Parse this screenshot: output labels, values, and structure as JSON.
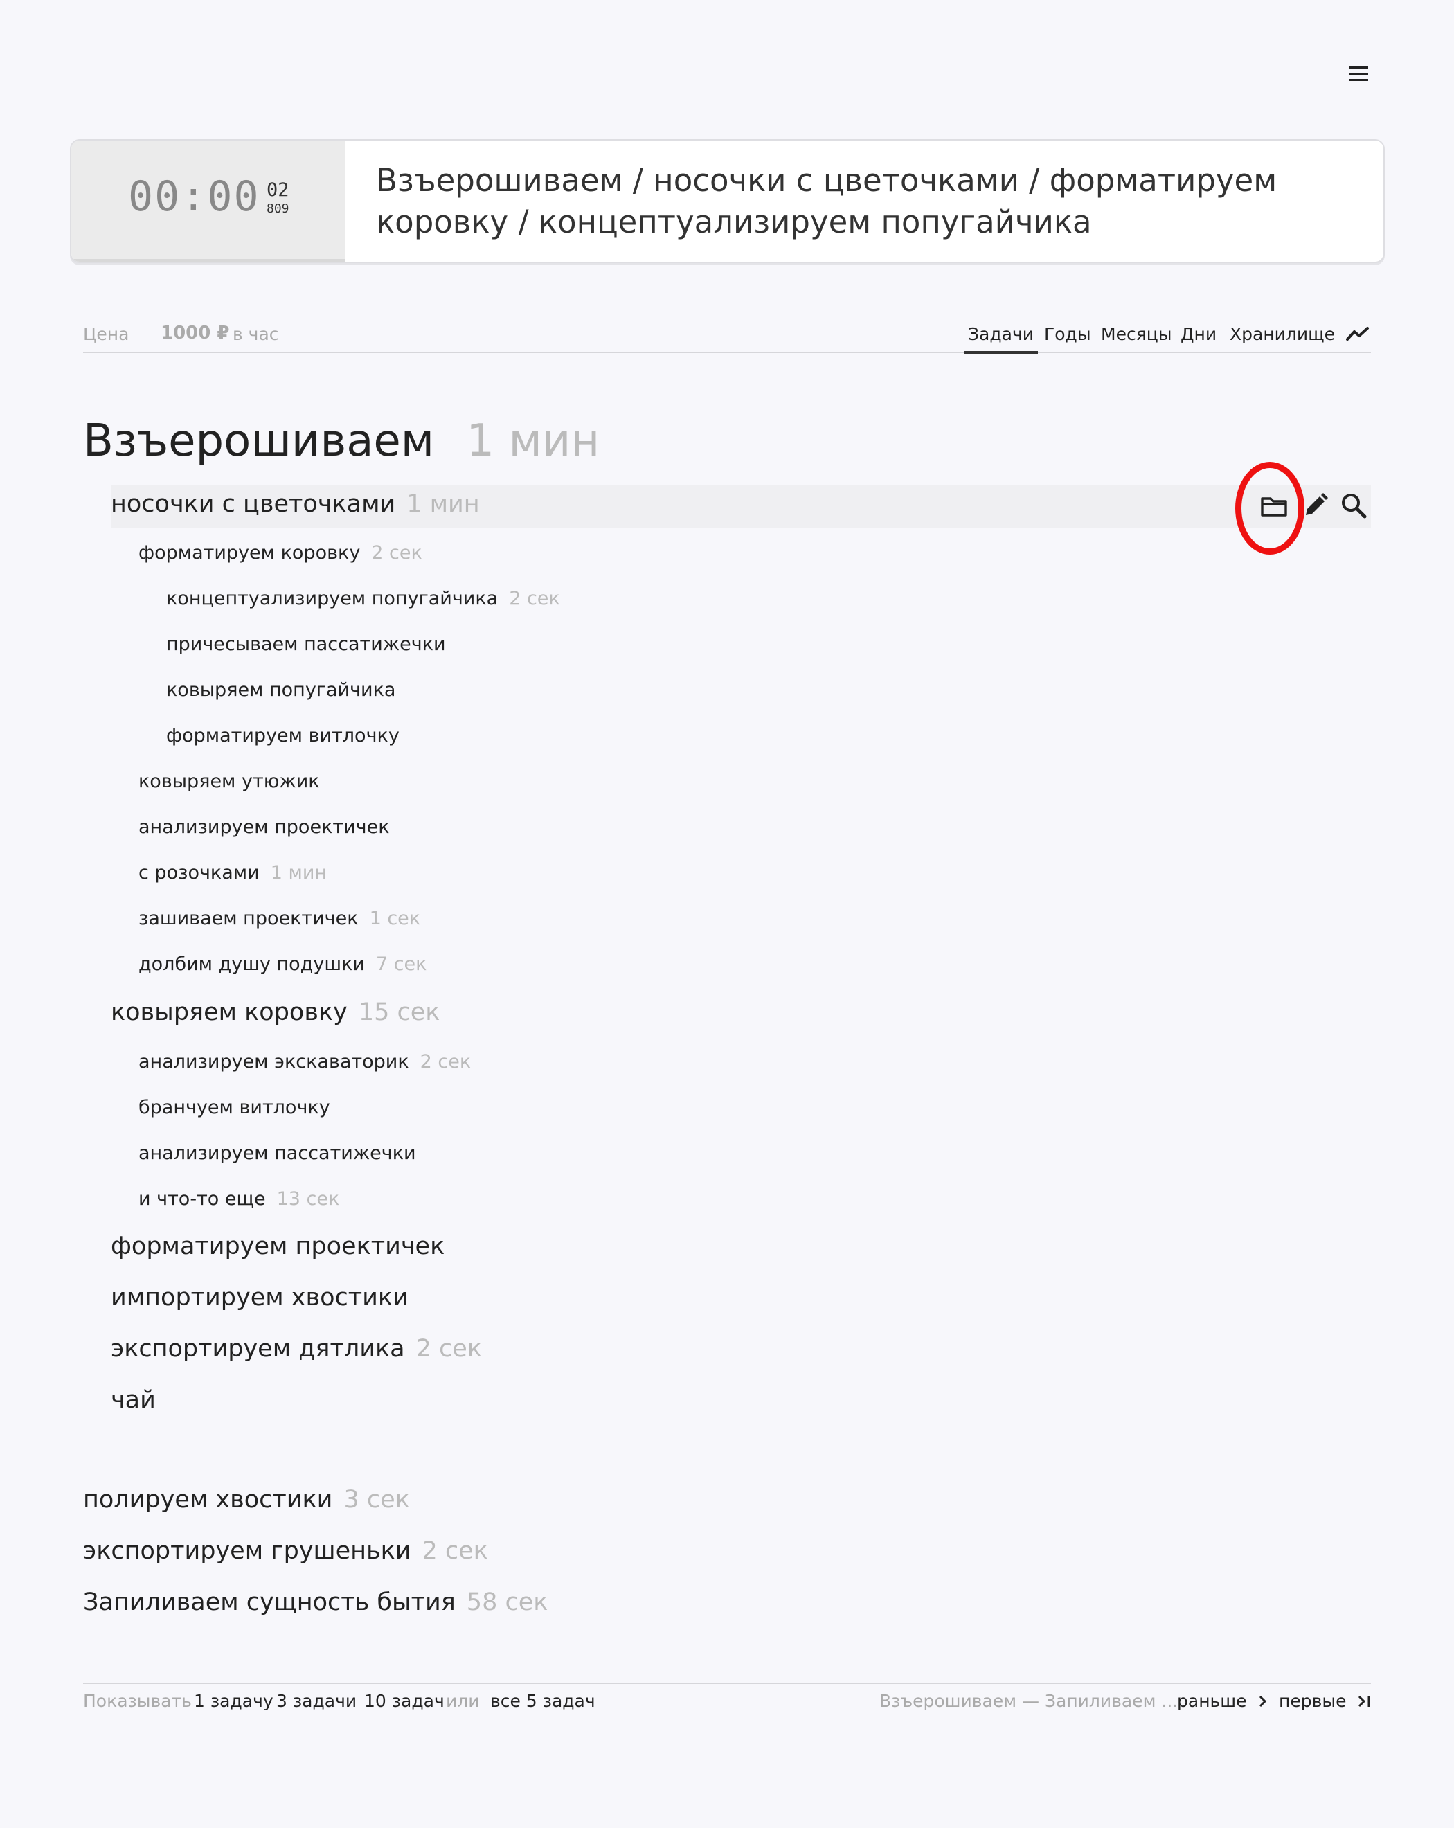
{
  "timer": {
    "main": "00:00",
    "seconds": "02",
    "millis": "809"
  },
  "current_path": "Взъерошиваем / носочки с цветочками / форматируем коровку / концептуализируем попугайчика",
  "price": {
    "label": "Цена",
    "value": "1000 ₽",
    "unit": "в час"
  },
  "tabs": [
    {
      "label": "Задачи",
      "active": true
    },
    {
      "label": "Годы"
    },
    {
      "label": "Месяцы"
    },
    {
      "label": "Дни"
    },
    {
      "label": "Хранилище"
    }
  ],
  "project": {
    "title": "Взъерошиваем",
    "duration": "1 мин"
  },
  "tasks": [
    {
      "label": "носочки с цветочками",
      "duration": "1 мин"
    },
    {
      "label": "форматируем коровку",
      "duration": "2 сек"
    },
    {
      "label": "концептуализируем попугайчика",
      "duration": "2 сек"
    },
    {
      "label": "причесываем пассатижечки",
      "duration": ""
    },
    {
      "label": "ковыряем попугайчика",
      "duration": ""
    },
    {
      "label": "форматируем витлочку",
      "duration": ""
    },
    {
      "label": "ковыряем утюжик",
      "duration": ""
    },
    {
      "label": "анализируем проектичек",
      "duration": ""
    },
    {
      "label": "с розочками",
      "duration": "1 мин"
    },
    {
      "label": "зашиваем проектичек",
      "duration": "1 сек"
    },
    {
      "label": "долбим душу подушки",
      "duration": "7 сек"
    },
    {
      "label": "ковыряем коровку",
      "duration": "15 сек"
    },
    {
      "label": "анализируем экскаваторик",
      "duration": "2 сек"
    },
    {
      "label": "бранчуем витлочку",
      "duration": ""
    },
    {
      "label": "анализируем пассатижечки",
      "duration": ""
    },
    {
      "label": "и что-то еще",
      "duration": "13 сек"
    },
    {
      "label": "форматируем проектичек",
      "duration": ""
    },
    {
      "label": "импортируем хвостики",
      "duration": ""
    },
    {
      "label": "экспортируем дятлика",
      "duration": "2 сек"
    },
    {
      "label": "чай",
      "duration": ""
    }
  ],
  "other_projects": [
    {
      "label": "полируем хвостики",
      "duration": "3 сек"
    },
    {
      "label": "экспортируем грушеньки",
      "duration": "2 сек"
    },
    {
      "label": "Запиливаем сущность бытия",
      "duration": "58 сек"
    }
  ],
  "footer": {
    "show_label": "Показывать",
    "opt1": "1 задачу",
    "opt3": "3 задачи",
    "opt10": "10 задач",
    "or": "или",
    "all": "все 5 задач",
    "range": "Взъерошиваем — Запиливаем ...",
    "earlier": "раньше",
    "first": "первые"
  },
  "icons": {
    "menu": "menu-icon",
    "trend": "trend-icon",
    "folder": "folder-icon",
    "edit": "pencil-icon",
    "search": "search-icon",
    "chevron": "chevron-right-icon",
    "first": "skip-to-end-icon"
  },
  "colors": {
    "annotation": "#ee1111",
    "muted": "#bbbbbb"
  }
}
